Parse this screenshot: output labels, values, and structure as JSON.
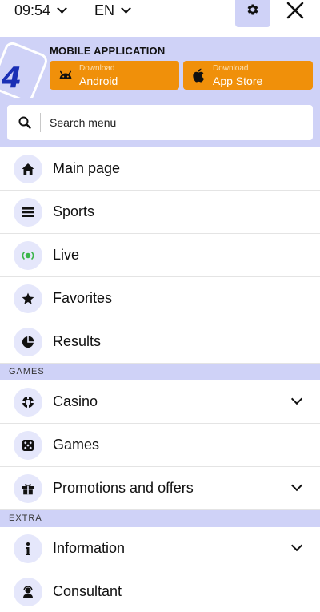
{
  "topbar": {
    "time_value": "09:54",
    "language_value": "EN"
  },
  "app_banner": {
    "title": "MOBILE APPLICATION",
    "android": {
      "caption": "Download",
      "label": "Android"
    },
    "ios": {
      "caption": "Download",
      "label": "App Store"
    }
  },
  "search": {
    "placeholder": "Search menu"
  },
  "menu": {
    "main_page": "Main page",
    "sports": "Sports",
    "live": "Live",
    "favorites": "Favorites",
    "results": "Results",
    "games_header": "GAMES",
    "casino": "Casino",
    "games": "Games",
    "promotions": "Promotions and offers",
    "extra_header": "EXTRA",
    "information": "Information",
    "consultant": "Consultant"
  },
  "icons": {
    "main_page": "home-icon",
    "sports": "list-icon",
    "live": "live-broadcast-icon",
    "favorites": "star-icon",
    "results": "pie-chart-icon",
    "casino": "poker-chip-icon",
    "games": "dice-icon",
    "promotions": "gift-icon",
    "information": "info-icon",
    "consultant": "support-agent-icon"
  },
  "colors": {
    "accent_lavender": "#cfd2f7",
    "icon_circle": "#e5e7fb",
    "download_orange": "#f0900a",
    "live_green": "#3ab54a",
    "logo_blue": "#1a2fb5"
  }
}
